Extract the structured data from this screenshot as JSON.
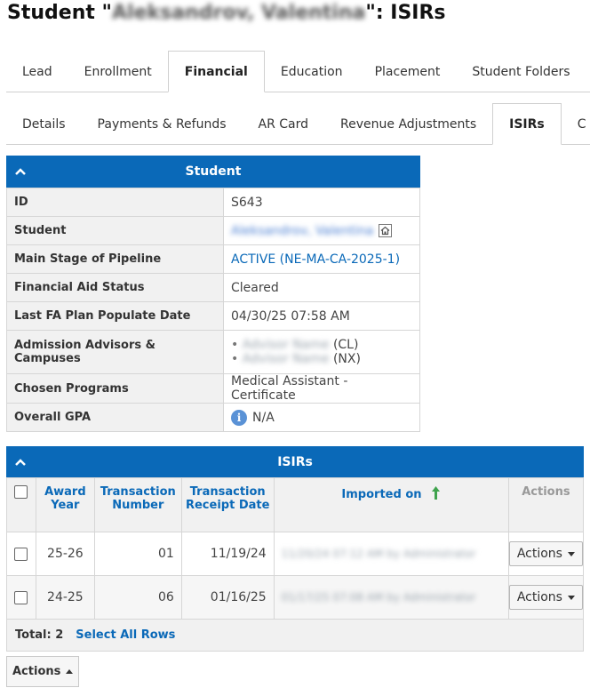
{
  "page": {
    "title_prefix": "Student \"",
    "title_name": "Aleksandrov, Valentina",
    "title_suffix": "\": ISIRs"
  },
  "tabs_primary": [
    {
      "label": "Lead"
    },
    {
      "label": "Enrollment"
    },
    {
      "label": "Financial",
      "active": true
    },
    {
      "label": "Education"
    },
    {
      "label": "Placement"
    },
    {
      "label": "Student Folders"
    }
  ],
  "tabs_secondary": [
    {
      "label": "Details"
    },
    {
      "label": "Payments & Refunds"
    },
    {
      "label": "AR Card"
    },
    {
      "label": "Revenue Adjustments"
    },
    {
      "label": "ISIRs",
      "active": true
    },
    {
      "label": "C"
    }
  ],
  "student_panel": {
    "header": "Student",
    "rows": {
      "id": {
        "label": "ID",
        "value": "S643"
      },
      "student": {
        "label": "Student",
        "value": "Aleksandrov, Valentina"
      },
      "stage": {
        "label": "Main Stage of Pipeline",
        "value": "ACTIVE (NE-MA-CA-2025-1)"
      },
      "fa_status": {
        "label": "Financial Aid Status",
        "value": "Cleared"
      },
      "fa_date": {
        "label": "Last FA Plan Populate Date",
        "value": "04/30/25 07:58 AM"
      },
      "advisors": {
        "label": "Admission Advisors & Campuses",
        "items": [
          {
            "name": "Advisor Name",
            "campus": "(CL)"
          },
          {
            "name": "Advisor Name",
            "campus": "(NX)"
          }
        ]
      },
      "programs": {
        "label": "Chosen Programs",
        "value": "Medical Assistant - Certificate"
      },
      "gpa": {
        "label": "Overall GPA",
        "value": "N/A"
      }
    }
  },
  "isirs": {
    "header": "ISIRs",
    "columns": {
      "award_year": "Award Year",
      "transaction_number": "Transaction Number",
      "receipt_date": "Transaction Receipt Date",
      "imported_on": "Imported on",
      "actions": "Actions"
    },
    "rows": [
      {
        "award_year": "25-26",
        "transaction_number": "01",
        "receipt_date": "11/19/24",
        "imported_on": "11/20/24 07:12 AM by Administrator",
        "actions": "Actions"
      },
      {
        "award_year": "24-25",
        "transaction_number": "06",
        "receipt_date": "01/16/25",
        "imported_on": "01/17/25 07:08 AM by Administrator",
        "actions": "Actions"
      }
    ],
    "footer": {
      "total": "Total: 2",
      "select_all": "Select All Rows"
    }
  },
  "bottom_actions": "Actions",
  "colors": {
    "accent": "#0a69b8",
    "sort_arrow": "#3fa34d"
  }
}
